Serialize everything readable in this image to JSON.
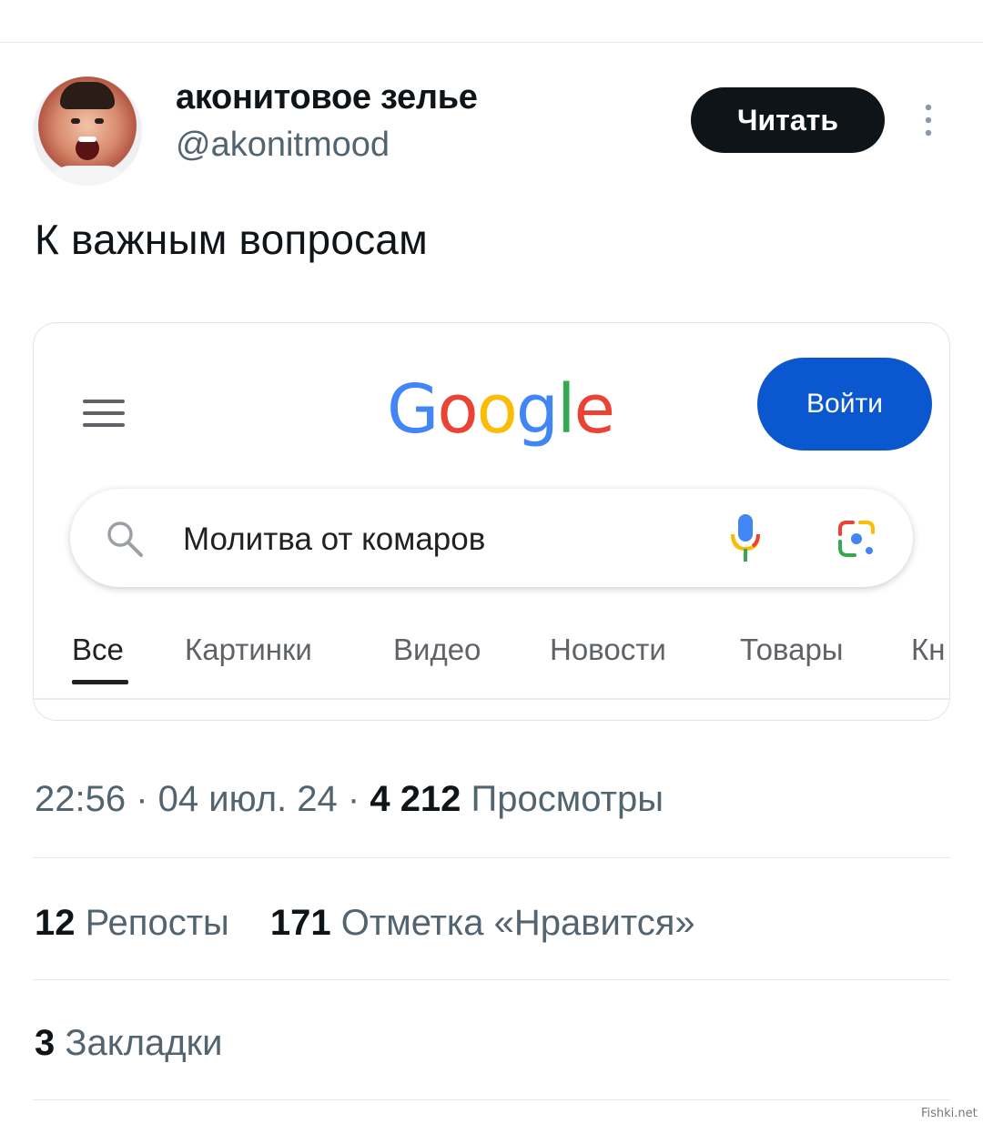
{
  "tweet": {
    "author": {
      "display_name": "аконитовое зелье",
      "handle": "@akonitmood"
    },
    "follow_label": "Читать",
    "more_icon": "more-vertical-icon",
    "text": "К важным вопросам",
    "timestamp": "22:56 · 04 июл. 24 · ",
    "views_count": "4 212",
    "views_label": " Просмотры",
    "reposts_count": "12",
    "reposts_label": " Репосты",
    "likes_count": "171",
    "likes_label": " Отметка «Нравится»",
    "bookmarks_count": "3",
    "bookmarks_label": " Закладки"
  },
  "google": {
    "menu_icon": "hamburger-menu-icon",
    "logo_letters": [
      {
        "char": "G",
        "color": "#4285F4"
      },
      {
        "char": "o",
        "color": "#EA4335"
      },
      {
        "char": "o",
        "color": "#FBBC05"
      },
      {
        "char": "g",
        "color": "#4285F4"
      },
      {
        "char": "l",
        "color": "#34A853"
      },
      {
        "char": "e",
        "color": "#EA4335"
      }
    ],
    "signin_label": "Войти",
    "search_query": "Молитва от комаров",
    "tabs": [
      "Все",
      "Картинки",
      "Видео",
      "Новости",
      "Товары",
      "Кн"
    ],
    "active_tab": "Все",
    "accent_color": "#0b57d0"
  },
  "watermark": "Fishki.net"
}
